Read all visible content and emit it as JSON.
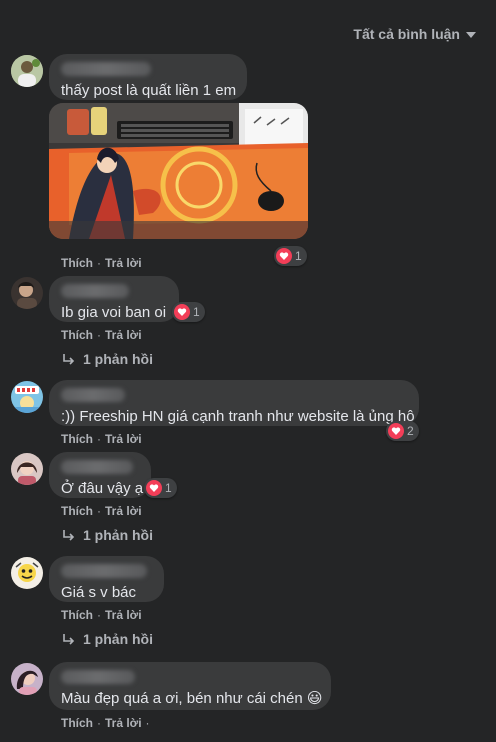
{
  "filter": {
    "label": "Tất cả bình luận"
  },
  "actions": {
    "like": "Thích",
    "dot": "·",
    "reply": "Trả lời"
  },
  "comments": [
    {
      "text": "thấy post là quất liền 1 em",
      "reactions": "1"
    },
    {
      "text": "Ib gia voi ban oi",
      "reactions": "1",
      "replies": "1 phản hồi"
    },
    {
      "text": ":)) Freeship HN giá cạnh tranh như website là ủng hộ",
      "reactions": "2"
    },
    {
      "text": "Ở đâu vậy ạ",
      "reactions": "1",
      "replies": "1 phản hồi"
    },
    {
      "text": "Giá s v bác",
      "replies": "1 phản hồi"
    },
    {
      "text": "Màu đẹp quá a ơi, bén như cái chén",
      "emoji": "😃"
    }
  ],
  "colors": {
    "background": "#242526",
    "bubble": "#3a3b3c",
    "heart": "#f33e58",
    "secondary_text": "#b0b3b8"
  }
}
